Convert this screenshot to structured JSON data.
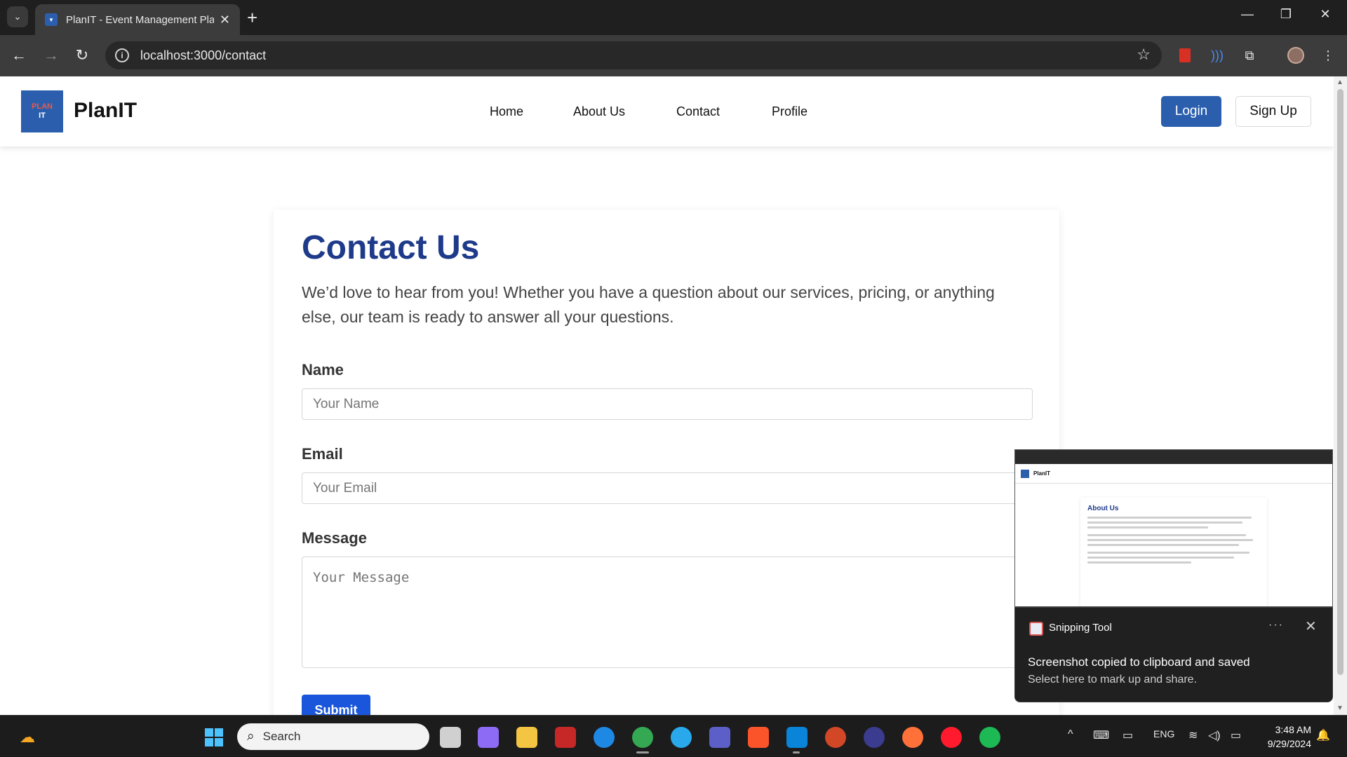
{
  "browser": {
    "tab_title": "PlanIT - Event Management Pla",
    "url": "localhost:3000/contact"
  },
  "site": {
    "logo_top": "PLAN",
    "logo_bottom": "IT",
    "brand": "PlanIT",
    "nav": [
      "Home",
      "About Us",
      "Contact",
      "Profile"
    ],
    "login_label": "Login",
    "signup_label": "Sign Up"
  },
  "contact": {
    "title": "Contact Us",
    "intro": "We’d love to hear from you! Whether you have a question about our services, pricing, or anything else, our team is ready to answer all your questions.",
    "name_label": "Name",
    "name_placeholder": "Your Name",
    "email_label": "Email",
    "email_placeholder": "Your Email",
    "message_label": "Message",
    "message_placeholder": "Your Message",
    "submit_label": "Submit"
  },
  "snip_preview": {
    "brand": "PlanIT",
    "card_title": "About Us"
  },
  "toast": {
    "app": "Snipping Tool",
    "message": "Screenshot copied to clipboard and saved",
    "sub": "Select here to mark up and share."
  },
  "taskbar": {
    "search_label": "Search",
    "language": "ENG",
    "time": "3:48 AM",
    "date": "9/29/2024"
  },
  "colors": {
    "brand_blue": "#2b5fae",
    "title_blue": "#1e3a8a",
    "submit_blue": "#1a56db"
  }
}
